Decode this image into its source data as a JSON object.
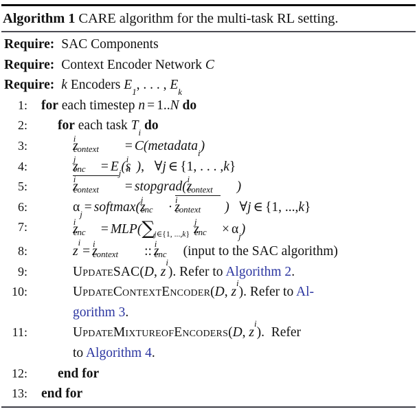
{
  "caption": {
    "label": "Algorithm 1",
    "text": "CARE algorithm for the multi-task RL setting."
  },
  "requires": [
    {
      "keyword": "Require:",
      "text": "SAC Components"
    },
    {
      "keyword": "Require:",
      "text": "Context Encoder Network C"
    },
    {
      "keyword": "Require:",
      "text": "k Encoders E1, . . . , Ek"
    }
  ],
  "lines": [
    {
      "number": "1:",
      "text": "for each timestep n = 1..N do"
    },
    {
      "number": "2:",
      "text": "for each task Ti do"
    },
    {
      "number": "3:",
      "text": "z^i_context = C(metadata_i)"
    },
    {
      "number": "4:",
      "text": "z^j_enc = Ej(s^i_n),  ∀j ∈ {1, . . . , k}"
    },
    {
      "number": "5:",
      "text": "z̄^i_context = stopgrad(z^i_context)"
    },
    {
      "number": "6:",
      "text": "αj = softmax(z^j_enc · z̄^i_context)  ∀j ∈ {1, ..., k}"
    },
    {
      "number": "7:",
      "text": "z^i_enc = MLP(Σ_{j∈{1,...,k}} z^j_enc × αj)"
    },
    {
      "number": "8:",
      "text": "z^i = z^i_context :: z^i_enc (input to the SAC algorithm)"
    },
    {
      "number": "9:",
      "text": "UpdateSAC(D, z^i). Refer to Algorithm 2."
    },
    {
      "number": "10:",
      "text": "UpdateContextEncoder(D, z^i). Refer to Algorithm 3."
    },
    {
      "number": "11:",
      "text": "UpdateMixtureofEncoders(D, z^i). Refer to Algorithm 4."
    },
    {
      "number": "12:",
      "text": "end for"
    },
    {
      "number": "13:",
      "text": "end for"
    }
  ],
  "tokens": {
    "for": "for",
    "do": "do",
    "end_for": "end for",
    "each_timestep": "each timestep",
    "each_task": "each task",
    "eq": "=",
    "one_dot_dot": "1..",
    "N": "N",
    "C": "C",
    "metadata": "metadata",
    "stopgrad": "stopgrad",
    "softmax": "softmax",
    "MLP": "MLP",
    "E": "E",
    "s": "s",
    "z": "z",
    "alpha": "α",
    "forall": "∀",
    "in": "∈",
    "brace_open": "{",
    "brace_close": "}",
    "one": "1",
    "ellipsis_math": ", . . . ,",
    "ellipsis_tight": ", ...,",
    "k": "k",
    "j": "j",
    "i": "i",
    "n": "n",
    "dot_product": "·",
    "times": "×",
    "comma": ",",
    "colon_colon": "::",
    "paren_open": "(",
    "paren_close": ")",
    "sum": "∑",
    "context": "context",
    "enc": "enc",
    "sac_note": "(input to the SAC algorithm)",
    "update_prefix": "Update",
    "sac": "SAC",
    "context_encoder": "ContextEncoder",
    "mixture_of_encoders": "MixtureofEncoders",
    "D": "D",
    "refer_to": ". Refer to ",
    "period": ".",
    "algorithm_2": "Algorithm 2",
    "algorithm_3_part1": "Al-",
    "algorithm_3_part2": "gorithm 3",
    "algorithm_4_prefix": "to ",
    "algorithm_4": "Algorithm 4",
    "refer_word": "Refer",
    "T": "T",
    "E_sub1": "1",
    "Encoders": "Encoders",
    "sac_components": "SAC Components",
    "context_encoder_network": "Context Encoder Network"
  },
  "colors": {
    "link": "#2b35a0",
    "text": "#111111",
    "rule": "#0a0a0a"
  }
}
